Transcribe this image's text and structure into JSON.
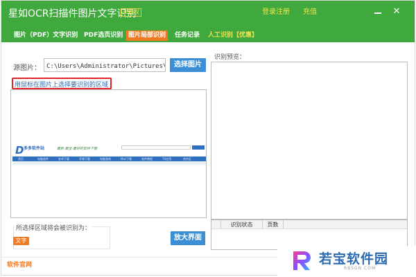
{
  "titlebar": {
    "title": "星如OCR扫描件图片文字识别",
    "badge": "未授权",
    "register_label": "登录注册",
    "recharge_label": "充值"
  },
  "tabs": [
    {
      "label": "图片（PDF）文字识别"
    },
    {
      "label": "PDF选页识别"
    },
    {
      "label": "图片局部识别"
    },
    {
      "label": "任务记录"
    },
    {
      "label": "人工识别【优惠】"
    }
  ],
  "left": {
    "source_label": "源图片：",
    "source_path": "C:\\Users\\Administrator\\Pictures\\筒",
    "select_button": "选择图片",
    "hint": "用鼠标在图片上选择要识别的区域",
    "preview": {
      "logo_text": "多多软件站",
      "slogan": "最新·最全·最好的软件下载",
      "nav": [
        "首页",
        "电脑软件",
        "安卓下载",
        "苹果下载",
        "电脑游戏",
        "Mac下载",
        "软件教程",
        "TV应用",
        "合作区"
      ]
    },
    "region_label": "所选择区域将会被识别为：",
    "region_tag": "文字",
    "zoom_button": "放大界面"
  },
  "right": {
    "preview_label": "识别预览：",
    "columns": [
      "识别状态",
      "页数"
    ]
  },
  "status": {
    "link": "软件官网"
  },
  "watermark": {
    "text": "若宝软件园",
    "sub": "RBSGN.COM"
  },
  "colors": {
    "titlebar": "#3fa93d",
    "active_tab": "#f07b23",
    "button": "#3c8fd4",
    "hint_border": "#e0242a"
  }
}
